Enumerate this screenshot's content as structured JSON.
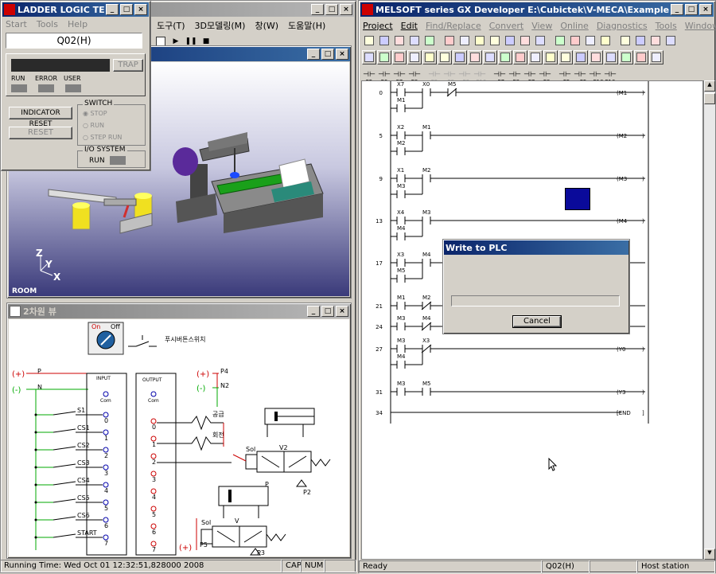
{
  "ladder_test": {
    "title": "LADDER LOGIC TEST ...",
    "menu": [
      "Start",
      "Tools",
      "Help"
    ],
    "cpu": "Q02(H)",
    "trap_label": "TRAP",
    "led_labels": [
      "RUN",
      "ERROR",
      "USER"
    ],
    "indicator_reset": "INDICATOR RESET",
    "reset": "RESET",
    "switch_group": "SWITCH",
    "switch_options": [
      "STOP",
      "RUN",
      "STEP RUN"
    ],
    "io_group": "I/O SYSTEM",
    "io_run": "RUN"
  },
  "sim_3d": {
    "menu_partial": [
      "도구(T)",
      "3D모델링(M)",
      "창(W)",
      "도움말(H)"
    ],
    "room_label": "ROOM",
    "axes": [
      "Z",
      "Y",
      "X"
    ]
  },
  "view2d": {
    "title": "2차원 뷰",
    "switch_on": "On",
    "switch_off": "Off",
    "pushbutton_label": "푸시버튼스위치",
    "plus": "(+)",
    "minus": "(-)",
    "p": "P",
    "n": "N",
    "p4": "P4",
    "n2": "N2",
    "p5": "P5",
    "input": "INPUT",
    "output": "OUTPUT",
    "com": "Com",
    "inputs": [
      "S1",
      "CS1",
      "CS2",
      "CS3",
      "CS4",
      "CS5",
      "CS6",
      "START"
    ],
    "input_nums": [
      "0",
      "1",
      "2",
      "3",
      "4",
      "5",
      "6",
      "7"
    ],
    "output_nums": [
      "0",
      "1",
      "2",
      "3",
      "4",
      "5",
      "6",
      "7"
    ],
    "lamp1": "공급",
    "lamp2": "회전",
    "sol1": "Sol",
    "sol2": "Sol",
    "v2": "V2",
    "v": "V",
    "p2": "P2",
    "p3": "P3",
    "p_label": "P"
  },
  "sim_status": {
    "running_time": "Running Time: Wed Oct 01 12:32:51,828000 2008",
    "cap": "CAP",
    "num": "NUM"
  },
  "gx": {
    "title": "MELSOFT series GX Developer E:\\Cubictek\\V-MECA\\Example\\MELSE...",
    "menu": [
      "Project",
      "Edit",
      "Find/Replace",
      "Convert",
      "View",
      "Online",
      "Diagnostics",
      "Tools",
      "Window",
      "Help"
    ],
    "fkeys": [
      {
        "k": "F5",
        "s": ""
      },
      {
        "k": "F6",
        "s": "sF5"
      },
      {
        "k": "F7",
        "s": "sF6"
      },
      {
        "k": "F8",
        "s": "sF7"
      },
      {
        "k": "F9",
        "s": ""
      },
      {
        "k": "sF9",
        "s": ""
      },
      {
        "k": "cF9",
        "s": ""
      },
      {
        "k": "cF10",
        "s": ""
      },
      {
        "k": "sF7",
        "s": ""
      },
      {
        "k": "sF8",
        "s": ""
      },
      {
        "k": "aF7",
        "s": ""
      },
      {
        "k": "aF8",
        "s": ""
      },
      {
        "k": "aF5",
        "s": ""
      },
      {
        "k": "caF5",
        "s": ""
      },
      {
        "k": "caF10",
        "s": ""
      },
      {
        "k": "F10",
        "s": ""
      }
    ],
    "rungs": [
      {
        "step": "0",
        "contacts": [
          "X7",
          "X0",
          "M5"
        ],
        "coil": "(M1",
        "branch": "M1"
      },
      {
        "step": "5",
        "contacts": [
          "X2",
          "M1"
        ],
        "coil": "(M2",
        "branch": "M2"
      },
      {
        "step": "9",
        "contacts": [
          "X1",
          "M2"
        ],
        "coil": "(M3",
        "branch": "M3"
      },
      {
        "step": "13",
        "contacts": [
          "X4",
          "M3"
        ],
        "coil": "(M4",
        "branch": "M4"
      },
      {
        "step": "17",
        "contacts": [
          "X3",
          "M4"
        ],
        "coil": "",
        "branch": "M5"
      },
      {
        "step": "21",
        "contacts": [
          "M1",
          "M2"
        ],
        "coil": "",
        "branch": ""
      },
      {
        "step": "24",
        "contacts": [
          "M3",
          "M4"
        ],
        "coil": "",
        "branch": ""
      },
      {
        "step": "27",
        "contacts": [
          "M3",
          "X3"
        ],
        "coil": "(Y0",
        "branch": "M4"
      },
      {
        "step": "31",
        "contacts": [
          "M3",
          "M5"
        ],
        "coil": "(Y3",
        "branch": ""
      },
      {
        "step": "34",
        "contacts": [],
        "coil": "[END",
        "branch": ""
      }
    ],
    "dialog_title": "Write to PLC",
    "dialog_cancel": "Cancel",
    "status_ready": "Ready",
    "status_cpu": "Q02(H)",
    "status_station": "Host station"
  },
  "colors": {
    "title_active": "#0a246a",
    "accent_blue": "#0a0a9a",
    "ladder_line": "#000000",
    "wire_red": "#cc0000",
    "wire_green": "#00aa00"
  }
}
